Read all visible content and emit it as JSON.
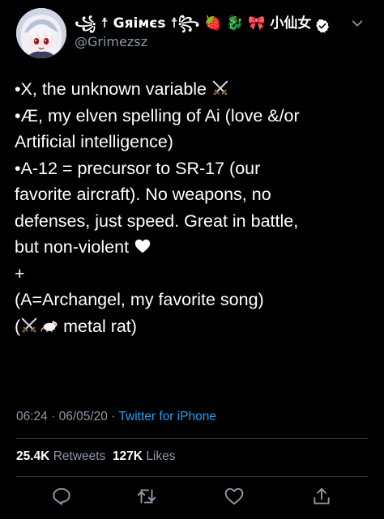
{
  "user": {
    "display_name": "꧁ ☨ Gяiмєs ☨꧂ 🍓 🐉 🎀 小仙女",
    "handle": "@Grimezsz",
    "verified": true
  },
  "tweet": {
    "lines": [
      {
        "text": "•X, the unknown variable ",
        "emoji": "crossed-swords"
      },
      {
        "text": "•Æ, my elven spelling of Ai (love &/or"
      },
      {
        "text": "Artificial intelligence)"
      },
      {
        "text": "•A-12 = precursor to SR-17 (our"
      },
      {
        "text": "favorite aircraft).  No weapons, no"
      },
      {
        "text": "defenses, just speed.  Great in battle,"
      },
      {
        "text": "but non-violent ",
        "emoji": "white-heart"
      },
      {
        "text": "+"
      },
      {
        "text": "(A=Archangel, my favorite song)"
      },
      {
        "text_before": "(",
        "text_after": " metal rat)"
      }
    ]
  },
  "meta": {
    "time": "06:24",
    "separator": " · ",
    "date": "06/05/20",
    "separator2": " · ",
    "source": "Twitter for iPhone"
  },
  "stats": {
    "retweets_count": "25.4K",
    "retweets_label": "Retweets",
    "likes_count": "127K",
    "likes_label": "Likes"
  },
  "actions": [
    "reply-icon",
    "retweet-icon",
    "like-icon",
    "share-icon"
  ],
  "colors": {
    "background": "#000000",
    "text": "#ffffff",
    "secondary": "#8b98a5",
    "link": "#1da1f2",
    "divider": "#2f3336"
  }
}
